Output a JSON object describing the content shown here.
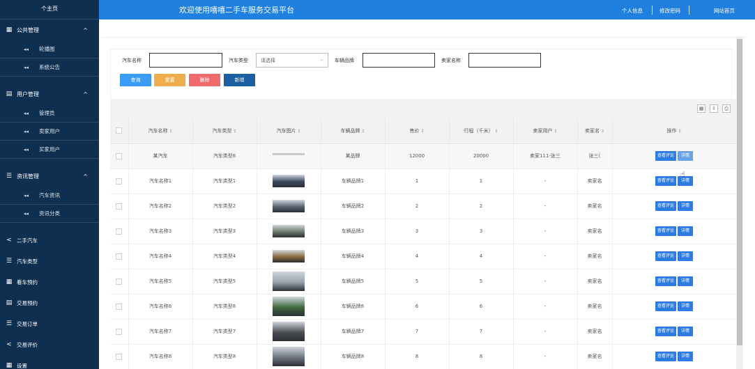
{
  "app": {
    "title": "欢迎使用嘻嘻二手车服务交易平台",
    "top_links": [
      "个人信息",
      "修改密码",
      "网站首页"
    ]
  },
  "sidebar": {
    "home": "个主页",
    "groups": [
      {
        "icon": "grid-icon",
        "glyph": "▦",
        "label": "公共管理",
        "chevron": "^",
        "items": [
          "轮播图",
          "系统公告"
        ]
      },
      {
        "icon": "doc-icon",
        "glyph": "▤",
        "label": "用户管理",
        "chevron": "^",
        "items": [
          "管理员",
          "卖家用户",
          "买家用户"
        ]
      },
      {
        "icon": "list-icon",
        "glyph": "☰",
        "label": "资讯管理",
        "chevron": "^",
        "items": [
          "汽车资讯",
          "资讯分类"
        ]
      }
    ],
    "flat": [
      {
        "icon": "share-icon",
        "glyph": "<",
        "label": "二手汽车"
      },
      {
        "icon": "list-icon",
        "glyph": "☰",
        "label": "汽车类型"
      },
      {
        "icon": "grid-icon",
        "glyph": "▦",
        "label": "看车预约"
      },
      {
        "icon": "doc-icon",
        "glyph": "▤",
        "label": "交易预约"
      },
      {
        "icon": "list-icon",
        "glyph": "☰",
        "label": "交易订单"
      },
      {
        "icon": "share-icon",
        "glyph": "<",
        "label": "交易评价"
      },
      {
        "icon": "grid-icon",
        "glyph": "▦",
        "label": "设置"
      }
    ],
    "sub_marker": "◂◂"
  },
  "search": {
    "labels": [
      "汽车名称",
      "汽车类型",
      "车辆品牌",
      "卖家名称"
    ],
    "select_value": "请选择",
    "buttons": [
      "查询",
      "重置",
      "删除",
      "新增"
    ],
    "button_colors": [
      "#3b9cf5",
      "#f0ad4e",
      "#f06b6b",
      "#1a5fa2"
    ]
  },
  "table": {
    "headers": [
      "汽车名称",
      "汽车类型",
      "汽车图片",
      "车辆品牌",
      "售价",
      "行程（千米）",
      "卖家用户",
      "卖家名",
      "操作"
    ],
    "op_labels": [
      "查看评论",
      "详情"
    ],
    "rows": [
      {
        "name": "某汽车",
        "type": "汽车类型6",
        "brand": "某品牌",
        "price": "12000",
        "mileage": "20000",
        "seller": "卖家111-张三",
        "seller_name": "张三(",
        "img": "none"
      },
      {
        "name": "汽车名称1",
        "type": "汽车类型1",
        "brand": "车辆品牌1",
        "price": "1",
        "mileage": "1",
        "seller": "-",
        "seller_name": "卖家名",
        "img": "#3a4a5e"
      },
      {
        "name": "汽车名称2",
        "type": "汽车类型2",
        "brand": "车辆品牌2",
        "price": "2",
        "mileage": "2",
        "seller": "-",
        "seller_name": "卖家名",
        "img": "#556270"
      },
      {
        "name": "汽车名称3",
        "type": "汽车类型3",
        "brand": "车辆品牌3",
        "price": "3",
        "mileage": "3",
        "seller": "-",
        "seller_name": "卖家名",
        "img": "#6b7a6a"
      },
      {
        "name": "汽车名称4",
        "type": "汽车类型4",
        "brand": "车辆品牌4",
        "price": "4",
        "mileage": "4",
        "seller": "-",
        "seller_name": "卖家名",
        "img": "#8a6a3c"
      },
      {
        "name": "汽车名称5",
        "type": "汽车类型5",
        "brand": "车辆品牌5",
        "price": "5",
        "mileage": "5",
        "seller": "-",
        "seller_name": "卖家名",
        "img": "#9aa3ad"
      },
      {
        "name": "汽车名称6",
        "type": "汽车类型6",
        "brand": "车辆品牌6",
        "price": "6",
        "mileage": "6",
        "seller": "-",
        "seller_name": "卖家名",
        "img": "#3f6a3a"
      },
      {
        "name": "汽车名称7",
        "type": "汽车类型7",
        "brand": "车辆品牌7",
        "price": "7",
        "mileage": "7",
        "seller": "-",
        "seller_name": "卖家名",
        "img": "#4a4e52"
      },
      {
        "name": "汽车名称8",
        "type": "汽车类型8",
        "brand": "车辆品牌8",
        "price": "8",
        "mileage": "8",
        "seller": "-",
        "seller_name": "卖家名",
        "img": "#6f7580"
      }
    ]
  }
}
